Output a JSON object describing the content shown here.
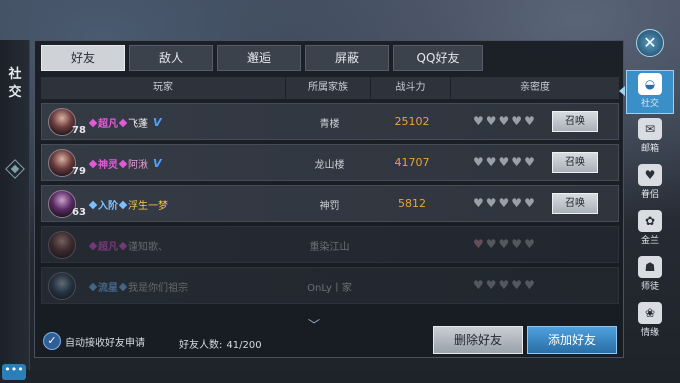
{
  "left_rail": {
    "title_1": "社",
    "title_2": "交"
  },
  "chat": {
    "label": "•••"
  },
  "tabs": [
    "好友",
    "敌人",
    "邂逅",
    "屏蔽",
    "QQ好友"
  ],
  "table": {
    "headers": [
      "玩家",
      "所属家族",
      "战斗力",
      "亲密度"
    ],
    "rows": [
      {
        "level": "78",
        "rank": "超凡",
        "rank_color": "#e15ad8",
        "name": "飞蓬",
        "name_color": "#f0f0f0",
        "vip": "V",
        "family": "青楼",
        "power": "25102",
        "hearts": 5,
        "summon": "召唤",
        "online": true
      },
      {
        "level": "79",
        "rank": "神灵",
        "rank_color": "#e15ad8",
        "name": "阿湫",
        "name_color": "#e89bd8",
        "vip": "V",
        "family": "龙山楼",
        "power": "41707",
        "hearts": 5,
        "summon": "召唤",
        "online": true
      },
      {
        "level": "63",
        "rank": "入阶",
        "rank_color": "#7ec0ff",
        "name": "浮生一梦",
        "name_color": "#f2c94c",
        "vip": "",
        "family": "神罚",
        "power": "5812",
        "hearts": 5,
        "summon": "召唤",
        "online": true
      },
      {
        "level": "",
        "rank": "超凡",
        "rank_color": "#e15ad8",
        "name": "谨知歌、",
        "name_color": "#c0c4c9",
        "vip": "",
        "family": "重染江山",
        "power": "",
        "hearts": 5,
        "summon": "",
        "online": false
      },
      {
        "level": "",
        "rank": "流星",
        "rank_color": "#7ec0ff",
        "name": "我是你们祖宗",
        "name_color": "#c0c4c9",
        "vip": "",
        "family": "OnLy丨家",
        "power": "",
        "hearts": 5,
        "summon": "",
        "online": false
      }
    ]
  },
  "footer": {
    "auto_accept_label": "自动接收好友申请",
    "friend_count_label": "好友人数:",
    "friend_count_value": "41/200",
    "delete_label": "删除好友",
    "add_label": "添加好友"
  },
  "side_menu": [
    {
      "label": "社交",
      "icon": "social-icon",
      "active": true
    },
    {
      "label": "邮箱",
      "icon": "mail-icon",
      "active": false
    },
    {
      "label": "眷侣",
      "icon": "couple-icon",
      "active": false
    },
    {
      "label": "金兰",
      "icon": "sworn-icon",
      "active": false
    },
    {
      "label": "师徒",
      "icon": "mentor-icon",
      "active": false
    },
    {
      "label": "情缘",
      "icon": "romance-icon",
      "active": false
    }
  ],
  "colors": {
    "accent": "#3a8fc8",
    "power": "#e7a43a",
    "vip": "#4ea1ff"
  }
}
